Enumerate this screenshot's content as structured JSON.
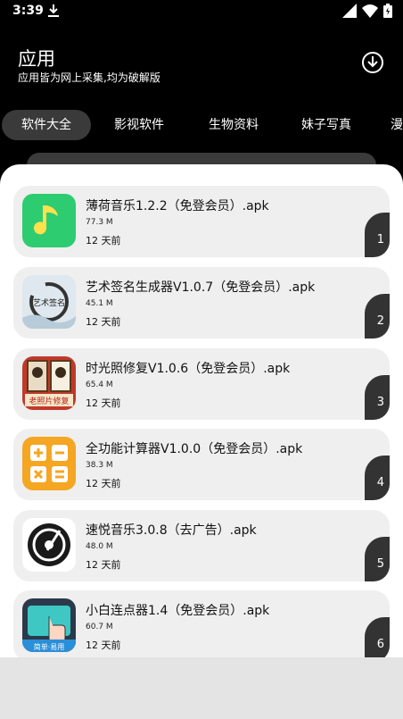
{
  "status": {
    "time": "3:39"
  },
  "header": {
    "title": "应用",
    "subtitle": "应用皆为网上采集,均为破解版"
  },
  "tabs": [
    {
      "label": "软件大全",
      "active": true
    },
    {
      "label": "影视软件",
      "active": false
    },
    {
      "label": "生物资料",
      "active": false
    },
    {
      "label": "妹子写真",
      "active": false
    },
    {
      "label": "漫",
      "active": false
    }
  ],
  "apps": [
    {
      "name": "薄荷音乐1.2.2（免登会员）.apk",
      "size": "77.3 M",
      "time": "12 天前",
      "index": "1",
      "icon": "music-note-icon"
    },
    {
      "name": "艺术签名生成器V1.0.7（免登会员）.apk",
      "size": "45.1 M",
      "time": "12 天前",
      "index": "2",
      "icon": "signature-art-icon",
      "icon_text": "艺术签名"
    },
    {
      "name": "时光照修复V1.0.6（免登会员）.apk",
      "size": "65.4 M",
      "time": "12 天前",
      "index": "3",
      "icon": "photo-restore-icon",
      "icon_text": "老照片修复"
    },
    {
      "name": "全功能计算器V1.0.0（免登会员）.apk",
      "size": "38.3 M",
      "time": "12 天前",
      "index": "4",
      "icon": "calculator-icon"
    },
    {
      "name": "速悦音乐3.0.8（去广告）.apk",
      "size": "48.0 M",
      "time": "12 天前",
      "index": "5",
      "icon": "vinyl-record-icon"
    },
    {
      "name": "小白连点器1.4（免登会员）.apk",
      "size": "60.7 M",
      "time": "12 天前",
      "index": "6",
      "icon": "tap-hand-icon",
      "icon_text": "简单·易用"
    }
  ],
  "colors": {
    "background": "#000000",
    "card": "#efefef",
    "badge": "#333333",
    "mint_green": "#2ecc71",
    "calc_orange": "#f5a623"
  }
}
